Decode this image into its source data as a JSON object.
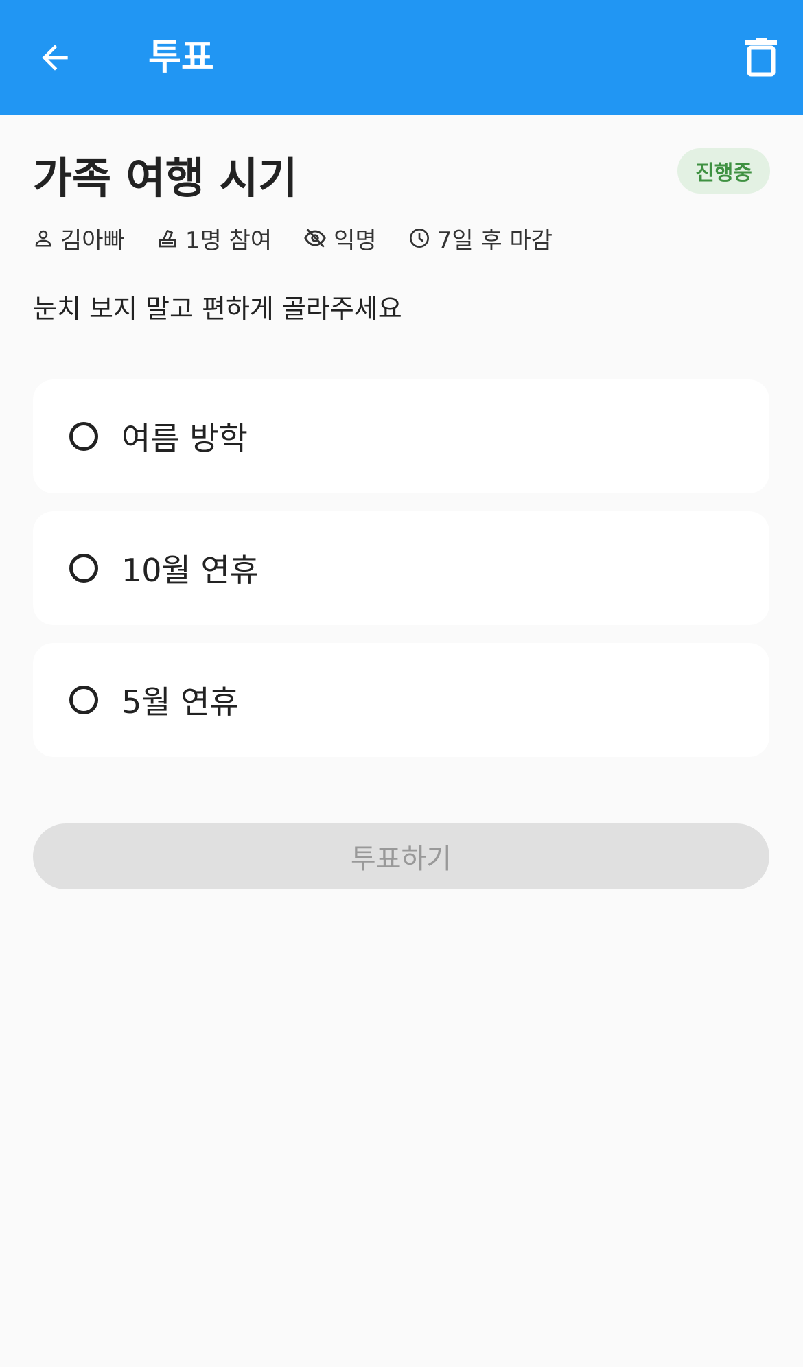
{
  "appbar": {
    "title": "투표",
    "back_icon": "arrow-left-icon",
    "delete_icon": "trash-icon",
    "background": "#2196f3"
  },
  "poll": {
    "title": "가족 여행 시기",
    "status": "진행중",
    "meta": {
      "author": "김아빠",
      "participants": "1명 참여",
      "anonymous": "익명",
      "deadline": "7일 후 마감"
    },
    "description": "눈치 보지 말고 편하게 골라주세요",
    "options": [
      {
        "label": "여름 방학",
        "selected": false
      },
      {
        "label": "10월 연휴",
        "selected": false
      },
      {
        "label": "5월 연휴",
        "selected": false
      }
    ],
    "vote_button": "투표하기"
  },
  "colors": {
    "badge_bg": "#e3f1e3",
    "badge_text": "#3f9142",
    "disabled_button": "#e0e0e0"
  }
}
